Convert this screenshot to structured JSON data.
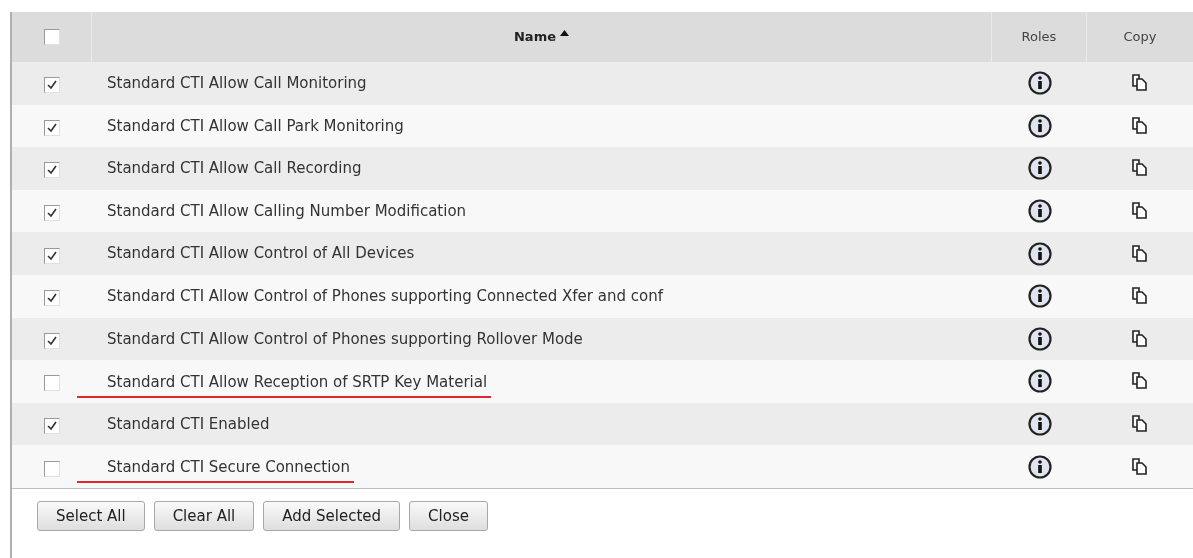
{
  "table": {
    "select_all_checked": false,
    "columns": [
      {
        "label": "Name",
        "sorted_ascending": true
      },
      {
        "label": "Roles"
      },
      {
        "label": "Copy"
      }
    ],
    "rows": [
      {
        "name": "Standard CTI Allow Call Monitoring",
        "checked": true,
        "underlined": false
      },
      {
        "name": "Standard CTI Allow Call Park Monitoring",
        "checked": true,
        "underlined": false
      },
      {
        "name": "Standard CTI Allow Call Recording",
        "checked": true,
        "underlined": false
      },
      {
        "name": "Standard CTI Allow Calling Number Modification",
        "checked": true,
        "underlined": false
      },
      {
        "name": "Standard CTI Allow Control of All Devices",
        "checked": true,
        "underlined": false
      },
      {
        "name": "Standard CTI Allow Control of Phones supporting Connected Xfer and conf",
        "checked": true,
        "underlined": false
      },
      {
        "name": "Standard CTI Allow Control of Phones supporting Rollover Mode",
        "checked": true,
        "underlined": false
      },
      {
        "name": "Standard CTI Allow Reception of SRTP Key Material",
        "checked": false,
        "underlined": true
      },
      {
        "name": "Standard CTI Enabled",
        "checked": true,
        "underlined": false
      },
      {
        "name": "Standard CTI Secure Connection",
        "checked": false,
        "underlined": true
      }
    ]
  },
  "buttons": [
    "Select All",
    "Clear All",
    "Add Selected",
    "Close"
  ]
}
